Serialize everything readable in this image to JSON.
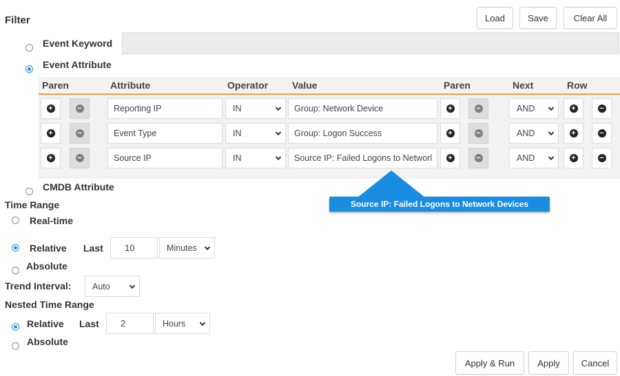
{
  "header": {
    "title": "Filter",
    "load_label": "Load",
    "save_label": "Save",
    "clear_all_label": "Clear All"
  },
  "filter_modes": {
    "event_keyword": {
      "label": "Event Keyword",
      "selected": false,
      "value": ""
    },
    "event_attribute": {
      "label": "Event Attribute",
      "selected": true
    },
    "cmdb_attribute": {
      "label": "CMDB Attribute",
      "selected": false
    }
  },
  "table": {
    "headers": [
      "Paren",
      "Attribute",
      "Operator",
      "Value",
      "Paren",
      "Next",
      "Row"
    ],
    "rows": [
      {
        "attribute": "Reporting IP",
        "operator": "IN",
        "value": "Group: Network Device",
        "next": "AND"
      },
      {
        "attribute": "Event Type",
        "operator": "IN",
        "value": "Group: Logon Success",
        "next": "AND"
      },
      {
        "attribute": "Source IP",
        "operator": "IN",
        "value": "Source IP: Failed Logons to Networl",
        "next": "AND"
      }
    ]
  },
  "tooltip": {
    "text": "Source IP: Failed Logons to Network Devices",
    "color": "#1a8de3"
  },
  "time_range": {
    "title": "Time Range",
    "realtime_label": "Real-time",
    "relative_label": "Relative",
    "last_label": "Last",
    "last_value": "10",
    "unit": "Minutes",
    "absolute_label": "Absolute",
    "selected": "relative"
  },
  "trend": {
    "label": "Trend Interval:",
    "value": "Auto"
  },
  "nested_time_range": {
    "title": "Nested Time Range",
    "relative_label": "Relative",
    "last_label": "Last",
    "last_value": "2",
    "unit": "Hours",
    "absolute_label": "Absolute",
    "selected": "relative"
  },
  "footer": {
    "apply_run_label": "Apply & Run",
    "apply_label": "Apply",
    "cancel_label": "Cancel"
  },
  "colors": {
    "accent": "#2b8be0",
    "header_underline": "#f0a23a"
  },
  "icons": {
    "add": "plus-circle-icon",
    "remove": "minus-circle-icon",
    "dropdown": "chevron-down-icon"
  }
}
